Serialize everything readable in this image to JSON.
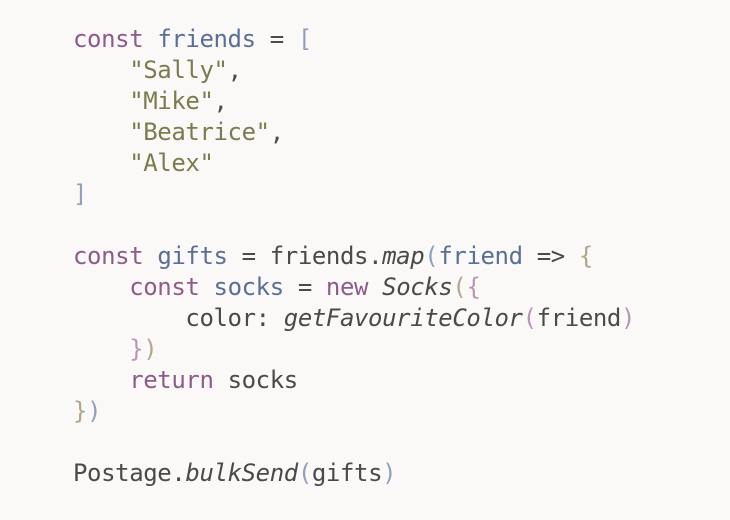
{
  "code": {
    "lines": [
      [
        {
          "t": "const",
          "c": "kw"
        },
        {
          "t": " "
        },
        {
          "t": "friends",
          "c": "var"
        },
        {
          "t": " = ",
          "c": "op"
        },
        {
          "t": "[",
          "c": "br1"
        }
      ],
      [
        {
          "t": "    "
        },
        {
          "t": "\"Sally\"",
          "c": "str"
        },
        {
          "t": ",",
          "c": "plain"
        }
      ],
      [
        {
          "t": "    "
        },
        {
          "t": "\"Mike\"",
          "c": "str"
        },
        {
          "t": ",",
          "c": "plain"
        }
      ],
      [
        {
          "t": "    "
        },
        {
          "t": "\"Beatrice\"",
          "c": "str"
        },
        {
          "t": ",",
          "c": "plain"
        }
      ],
      [
        {
          "t": "    "
        },
        {
          "t": "\"Alex\"",
          "c": "str"
        }
      ],
      [
        {
          "t": "]",
          "c": "br1"
        }
      ],
      [],
      [
        {
          "t": "const",
          "c": "kw"
        },
        {
          "t": " "
        },
        {
          "t": "gifts",
          "c": "var"
        },
        {
          "t": " = ",
          "c": "op"
        },
        {
          "t": "friends.",
          "c": "plain"
        },
        {
          "t": "map",
          "c": "fn"
        },
        {
          "t": "(",
          "c": "br1"
        },
        {
          "t": "friend",
          "c": "var"
        },
        {
          "t": " => ",
          "c": "op"
        },
        {
          "t": "{",
          "c": "br2"
        }
      ],
      [
        {
          "t": "    "
        },
        {
          "t": "const",
          "c": "kw"
        },
        {
          "t": " "
        },
        {
          "t": "socks",
          "c": "var"
        },
        {
          "t": " = ",
          "c": "op"
        },
        {
          "t": "new",
          "c": "kw"
        },
        {
          "t": " "
        },
        {
          "t": "Socks",
          "c": "cls"
        },
        {
          "t": "(",
          "c": "br2"
        },
        {
          "t": "{",
          "c": "br3"
        }
      ],
      [
        {
          "t": "        "
        },
        {
          "t": "color: ",
          "c": "plain"
        },
        {
          "t": "getFavouriteColor",
          "c": "fn"
        },
        {
          "t": "(",
          "c": "br3"
        },
        {
          "t": "friend",
          "c": "plain"
        },
        {
          "t": ")",
          "c": "br3"
        }
      ],
      [
        {
          "t": "    "
        },
        {
          "t": "}",
          "c": "br3"
        },
        {
          "t": ")",
          "c": "br2"
        }
      ],
      [
        {
          "t": "    "
        },
        {
          "t": "return",
          "c": "kw"
        },
        {
          "t": " "
        },
        {
          "t": "socks",
          "c": "plain"
        }
      ],
      [
        {
          "t": "}",
          "c": "br2"
        },
        {
          "t": ")",
          "c": "br1"
        }
      ],
      [],
      [
        {
          "t": "Postage.",
          "c": "plain"
        },
        {
          "t": "bulkSend",
          "c": "fn"
        },
        {
          "t": "(",
          "c": "br1"
        },
        {
          "t": "gifts",
          "c": "plain"
        },
        {
          "t": ")",
          "c": "br1"
        }
      ]
    ]
  }
}
